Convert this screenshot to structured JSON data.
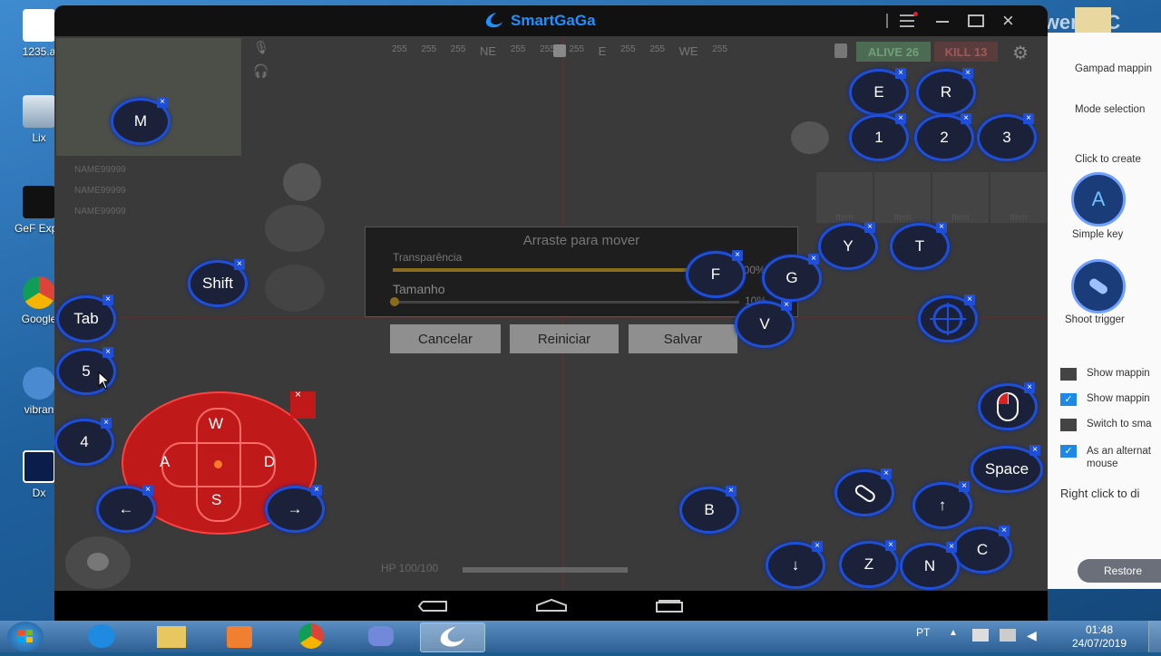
{
  "desktop": {
    "icons": [
      {
        "label": "1235.a"
      },
      {
        "label": "Lix"
      },
      {
        "label": "GeF Expe"
      },
      {
        "label": "Google"
      },
      {
        "label": "vibran"
      },
      {
        "label": "Dx"
      }
    ]
  },
  "window": {
    "title": "SmartGaGa",
    "recorder_label": "ApowerREC"
  },
  "hud": {
    "alive": "ALIVE 26",
    "kill": "KILL 13",
    "compass": [
      "255",
      "255",
      "255",
      "NE",
      "255",
      "255",
      "255",
      "E",
      "255",
      "255",
      "WE",
      "255"
    ],
    "hp": "HP 100/100",
    "item_label": "Item",
    "players": [
      "NAME99999",
      "NAME99999",
      "NAME99999"
    ]
  },
  "dialog": {
    "title": "Arraste para mover",
    "transparency_label": "Transparência",
    "size_label": "Tamanho",
    "transparency_value": "100%",
    "size_value": "10%",
    "transparency_level": 0.97,
    "size_level": 0.01,
    "cancel": "Cancelar",
    "reset": "Reiniciar",
    "save": "Salvar"
  },
  "keys": {
    "m": "M",
    "e": "E",
    "r": "R",
    "one": "1",
    "two": "2",
    "three": "3",
    "shift": "Shift",
    "tab": "Tab",
    "five": "5",
    "four": "4",
    "y": "Y",
    "t": "T",
    "f": "F",
    "g": "G",
    "v": "V",
    "space": "Space",
    "b": "B",
    "up": "↑",
    "down": "↓",
    "z": "Z",
    "n": "N",
    "c": "C",
    "left": "←",
    "right": "→",
    "w": "W",
    "a": "A",
    "s": "S",
    "d": "D",
    "close": "×"
  },
  "panel": {
    "gamepad": "Gampad mappin",
    "mode": "Mode selection",
    "click_create": "Click to create",
    "simple_key_letter": "A",
    "simple_key": "Simple key",
    "shoot_trigger": "Shoot trigger",
    "options": [
      {
        "label": "Show mappin",
        "checked": false
      },
      {
        "label": "Show mappin",
        "checked": true
      },
      {
        "label": "Switch to sma",
        "checked": false
      },
      {
        "label": "As an alternat\nmouse",
        "checked": true
      }
    ],
    "right_click": "Right click to di",
    "restore": "Restore",
    "check_mark": "✓"
  },
  "taskbar": {
    "lang": "PT",
    "time": "01:48",
    "date": "24/07/2019"
  },
  "colors": {
    "key_border": "#1f4fd8",
    "dpad": "#e01010",
    "accent_blue": "#1e88e5"
  }
}
